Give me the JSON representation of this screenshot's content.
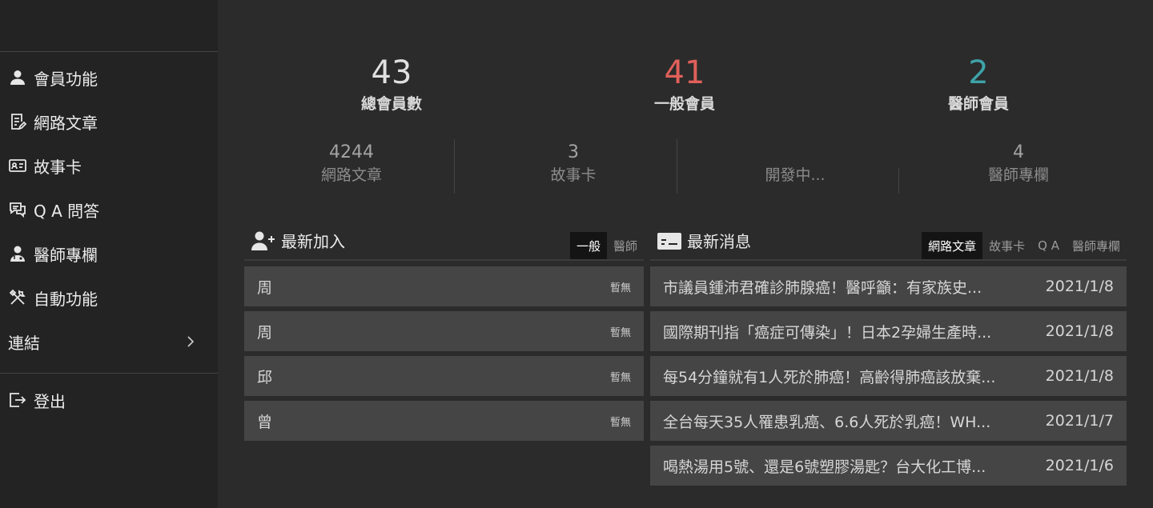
{
  "sidebar": {
    "items": [
      {
        "label": "會員功能"
      },
      {
        "label": "網路文章"
      },
      {
        "label": "故事卡"
      },
      {
        "label": "Q A 問答"
      },
      {
        "label": "醫師專欄"
      },
      {
        "label": "自動功能"
      },
      {
        "label": "連結"
      }
    ],
    "logout": "登出"
  },
  "stats": {
    "total": {
      "value": "43",
      "label": "總會員數",
      "color": "#e0e0e0"
    },
    "general": {
      "value": "41",
      "label": "一般會員",
      "color": "#e0605a"
    },
    "doctor": {
      "value": "2",
      "label": "醫師會員",
      "color": "#3ea3a8"
    }
  },
  "substats": [
    {
      "value": "4244",
      "label": "網路文章"
    },
    {
      "value": "3",
      "label": "故事卡"
    },
    {
      "value": "",
      "label": "開發中..."
    },
    {
      "value": "4",
      "label": "醫師專欄"
    }
  ],
  "members": {
    "title": "最新加入",
    "tabs": [
      "一般",
      "醫師"
    ],
    "rows": [
      {
        "name": "周",
        "tag": "暫無"
      },
      {
        "name": "周",
        "tag": "暫無"
      },
      {
        "name": "邱",
        "tag": "暫無"
      },
      {
        "name": "曾",
        "tag": "暫無"
      }
    ]
  },
  "news": {
    "title": "最新消息",
    "tabs": [
      "網路文章",
      "故事卡",
      "Q A",
      "醫師專欄"
    ],
    "rows": [
      {
        "title": "市議員鍾沛君確診肺腺癌！醫呼籲：有家族史...",
        "date": "2021/1/8"
      },
      {
        "title": "國際期刊指「癌症可傳染」！日本2孕婦生產時...",
        "date": "2021/1/8"
      },
      {
        "title": "每54分鐘就有1人死於肺癌！高齡得肺癌該放棄...",
        "date": "2021/1/8"
      },
      {
        "title": "全台每天35人罹患乳癌、6.6人死於乳癌！WH...",
        "date": "2021/1/7"
      },
      {
        "title": "喝熱湯用5號、還是6號塑膠湯匙？台大化工博...",
        "date": "2021/1/6"
      }
    ]
  }
}
